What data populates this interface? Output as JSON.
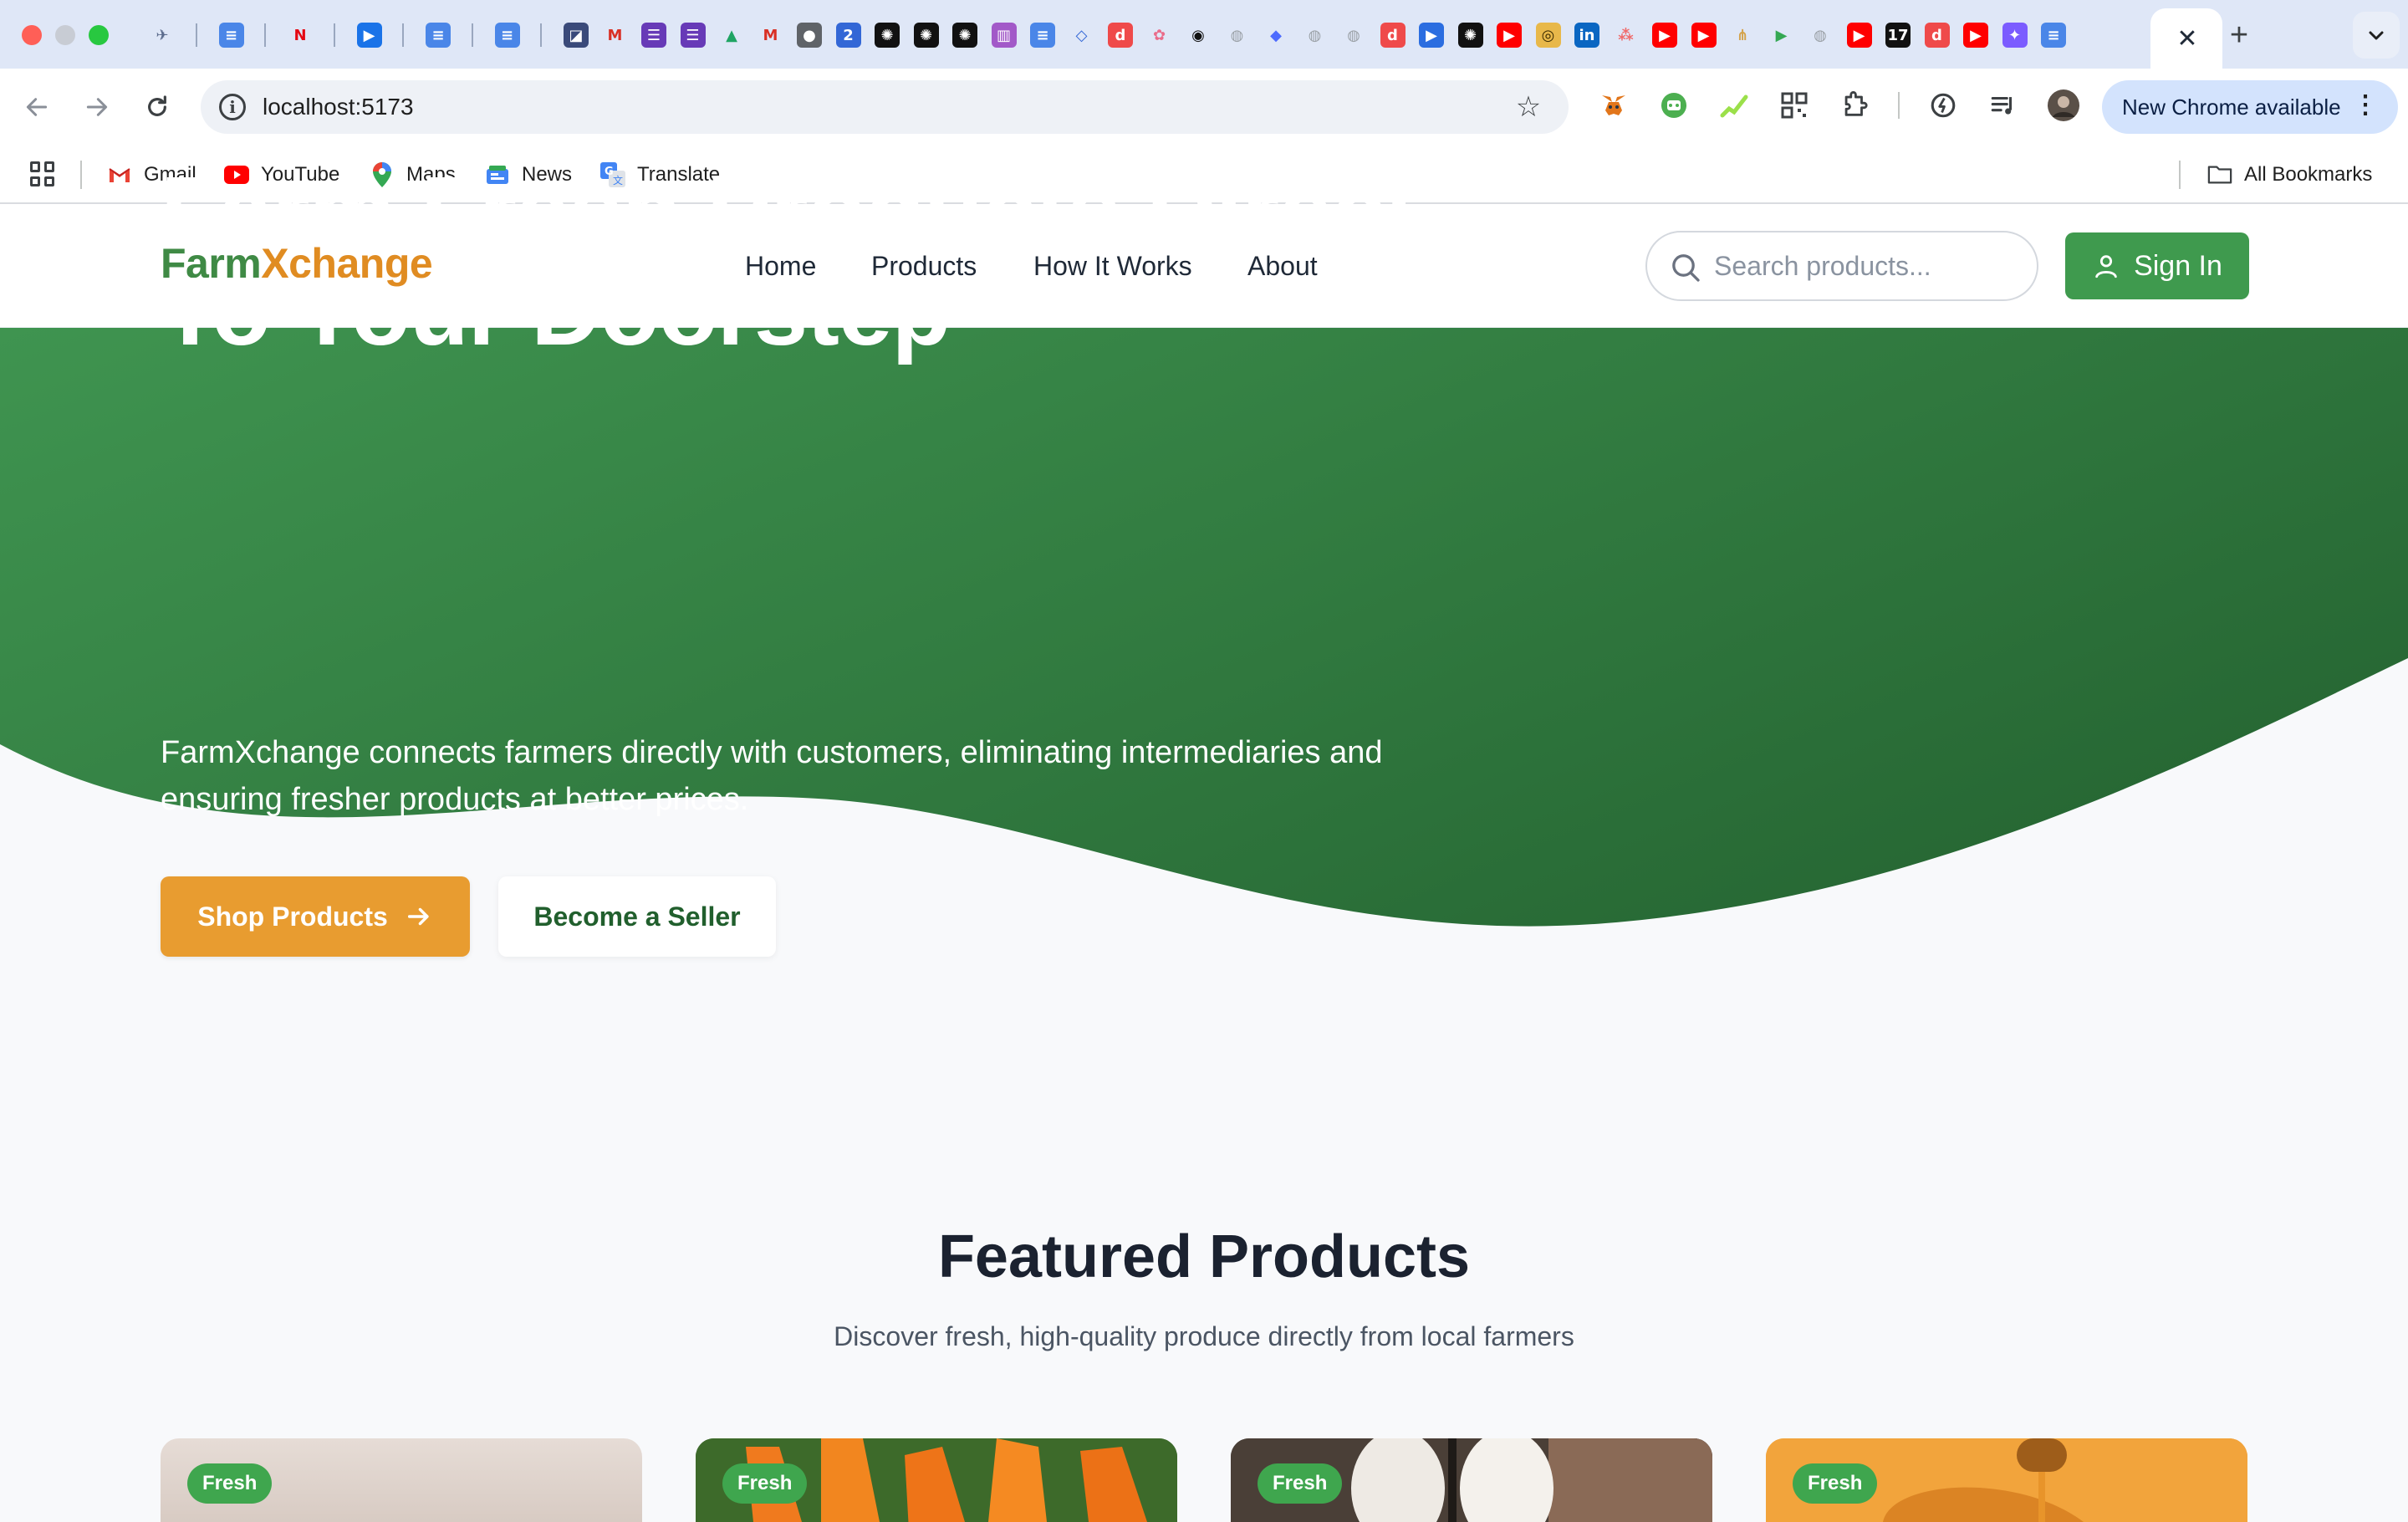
{
  "browser": {
    "url": "localhost:5173",
    "update_label": "New Chrome available",
    "tab_icons": [
      {
        "icon": "plane-icon",
        "glyph": "✈",
        "bg": "#dfe7f7",
        "fg": "#5b6b8c"
      },
      {
        "icon": "sep"
      },
      {
        "icon": "google-docs-icon",
        "glyph": "≡",
        "bg": "#4a86e8",
        "fg": "#fff"
      },
      {
        "icon": "sep"
      },
      {
        "icon": "netflix-icon",
        "glyph": "N",
        "bg": "#dfe7f7",
        "fg": "#e50914"
      },
      {
        "icon": "sep"
      },
      {
        "icon": "play-icon",
        "glyph": "▶",
        "bg": "#1a73e8",
        "fg": "#fff"
      },
      {
        "icon": "sep"
      },
      {
        "icon": "google-docs-icon",
        "glyph": "≡",
        "bg": "#4a86e8",
        "fg": "#fff"
      },
      {
        "icon": "sep"
      },
      {
        "icon": "google-docs-icon",
        "glyph": "≡",
        "bg": "#4a86e8",
        "fg": "#fff"
      },
      {
        "icon": "sep"
      },
      {
        "icon": "clapper-icon",
        "glyph": "◪",
        "bg": "#3a4a7a",
        "fg": "#fff"
      },
      {
        "icon": "gmail-icon",
        "glyph": "M",
        "bg": "#dfe7f7",
        "fg": "#d93025"
      },
      {
        "icon": "forms-icon",
        "glyph": "☰",
        "bg": "#673ab7",
        "fg": "#fff"
      },
      {
        "icon": "forms-icon",
        "glyph": "☰",
        "bg": "#673ab7",
        "fg": "#fff"
      },
      {
        "icon": "drive-icon",
        "glyph": "▲",
        "bg": "#dfe7f7",
        "fg": "#1fa463"
      },
      {
        "icon": "gmail-icon",
        "glyph": "M",
        "bg": "#dfe7f7",
        "fg": "#d93025"
      },
      {
        "icon": "rubberduck-icon",
        "glyph": "●",
        "bg": "#5f6368",
        "fg": "#fff"
      },
      {
        "icon": "badge-icon",
        "glyph": "2",
        "bg": "#3367d6",
        "fg": "#fff"
      },
      {
        "icon": "openai-icon",
        "glyph": "✺",
        "bg": "#111",
        "fg": "#fff"
      },
      {
        "icon": "openai-icon",
        "glyph": "✺",
        "bg": "#111",
        "fg": "#fff"
      },
      {
        "icon": "openai-icon",
        "glyph": "✺",
        "bg": "#111",
        "fg": "#fff"
      },
      {
        "icon": "trello-icon",
        "glyph": "▥",
        "bg": "#a259c8",
        "fg": "#fff"
      },
      {
        "icon": "google-docs-icon",
        "glyph": "≡",
        "bg": "#4a86e8",
        "fg": "#fff"
      },
      {
        "icon": "figma-jam-icon",
        "glyph": "◇",
        "bg": "#dfe7f7",
        "fg": "#3367d6"
      },
      {
        "icon": "d-icon",
        "glyph": "d",
        "bg": "#ef4a4a",
        "fg": "#fff"
      },
      {
        "icon": "pinwheel-icon",
        "glyph": "✿",
        "bg": "#dfe7f7",
        "fg": "#ea6c8a"
      },
      {
        "icon": "github-icon",
        "glyph": "◉",
        "bg": "#dfe7f7",
        "fg": "#111"
      },
      {
        "icon": "globe-icon",
        "glyph": "◍",
        "bg": "#dfe7f7",
        "fg": "#9aa0a6"
      },
      {
        "icon": "deepseek-icon",
        "glyph": "◆",
        "bg": "#dfe7f7",
        "fg": "#4d6bfe"
      },
      {
        "icon": "globe-icon",
        "glyph": "◍",
        "bg": "#dfe7f7",
        "fg": "#9aa0a6"
      },
      {
        "icon": "globe-icon",
        "glyph": "◍",
        "bg": "#dfe7f7",
        "fg": "#9aa0a6"
      },
      {
        "icon": "d-icon",
        "glyph": "d",
        "bg": "#ef4a4a",
        "fg": "#fff"
      },
      {
        "icon": "meet-icon",
        "glyph": "▶",
        "bg": "#2b6de0",
        "fg": "#fff"
      },
      {
        "icon": "openai-icon",
        "glyph": "✺",
        "bg": "#111",
        "fg": "#fff"
      },
      {
        "icon": "youtube-icon",
        "glyph": "▶",
        "bg": "#ff0000",
        "fg": "#fff"
      },
      {
        "icon": "app-icon",
        "glyph": "◎",
        "bg": "#e8b84a",
        "fg": "#3a2a00"
      },
      {
        "icon": "linkedin-icon",
        "glyph": "in",
        "bg": "#0a66c2",
        "fg": "#fff"
      },
      {
        "icon": "asana-icon",
        "glyph": "⁂",
        "bg": "#dfe7f7",
        "fg": "#f06a6a"
      },
      {
        "icon": "youtube-icon",
        "glyph": "▶",
        "bg": "#ff0000",
        "fg": "#fff"
      },
      {
        "icon": "youtube-icon",
        "glyph": "▶",
        "bg": "#ff0000",
        "fg": "#fff"
      },
      {
        "icon": "grass-icon",
        "glyph": "⋔",
        "bg": "#dfe7f7",
        "fg": "#d4a24a"
      },
      {
        "icon": "play-store-icon",
        "glyph": "▶",
        "bg": "#dfe7f7",
        "fg": "#34a853"
      },
      {
        "icon": "globe-icon",
        "glyph": "◍",
        "bg": "#dfe7f7",
        "fg": "#9aa0a6"
      },
      {
        "icon": "youtube-icon",
        "glyph": "▶",
        "bg": "#ff0000",
        "fg": "#fff"
      },
      {
        "icon": "seventeen-icon",
        "glyph": "17",
        "bg": "#111",
        "fg": "#fff"
      },
      {
        "icon": "d-icon",
        "glyph": "d",
        "bg": "#ef4a4a",
        "fg": "#fff"
      },
      {
        "icon": "youtube-icon",
        "glyph": "▶",
        "bg": "#ff0000",
        "fg": "#fff"
      },
      {
        "icon": "podcast-icon",
        "glyph": "✦",
        "bg": "#7b5cff",
        "fg": "#fff"
      },
      {
        "icon": "google-docs-icon",
        "glyph": "≡",
        "bg": "#4a86e8",
        "fg": "#fff"
      }
    ]
  },
  "bookmarks": [
    {
      "label": "Gmail",
      "icon": "gmail-icon"
    },
    {
      "label": "YouTube",
      "icon": "youtube-icon"
    },
    {
      "label": "Maps",
      "icon": "maps-icon"
    },
    {
      "label": "News",
      "icon": "news-icon"
    },
    {
      "label": "Translate",
      "icon": "translate-icon"
    }
  ],
  "all_bookmarks_label": "All Bookmarks",
  "site": {
    "logo_part1": "Farm",
    "logo_part2": "Xchange",
    "nav": [
      "Home",
      "Products",
      "How It Works",
      "About"
    ],
    "search_placeholder": "Search products...",
    "signin_label": "Sign In"
  },
  "hero": {
    "title_line1": "Farm Fresh Products Direct",
    "title_line2": "To Your Doorstep",
    "subtitle": "FarmXchange connects farmers directly with customers, eliminating intermediaries and ensuring fresher products at better prices.",
    "shop_label": "Shop Products",
    "seller_label": "Become a Seller"
  },
  "featured": {
    "title": "Featured Products",
    "subtitle": "Discover fresh, high-quality produce directly from local farmers",
    "cards": [
      {
        "badge": "Fresh"
      },
      {
        "badge": "Fresh"
      },
      {
        "badge": "Fresh"
      },
      {
        "badge": "Fresh"
      }
    ]
  },
  "colors": {
    "brand_green": "#3f8a45",
    "brand_orange": "#e08c22",
    "hero_green_start": "#3f9450",
    "hero_green_end": "#276834",
    "signin_green": "#3f9a4e"
  }
}
